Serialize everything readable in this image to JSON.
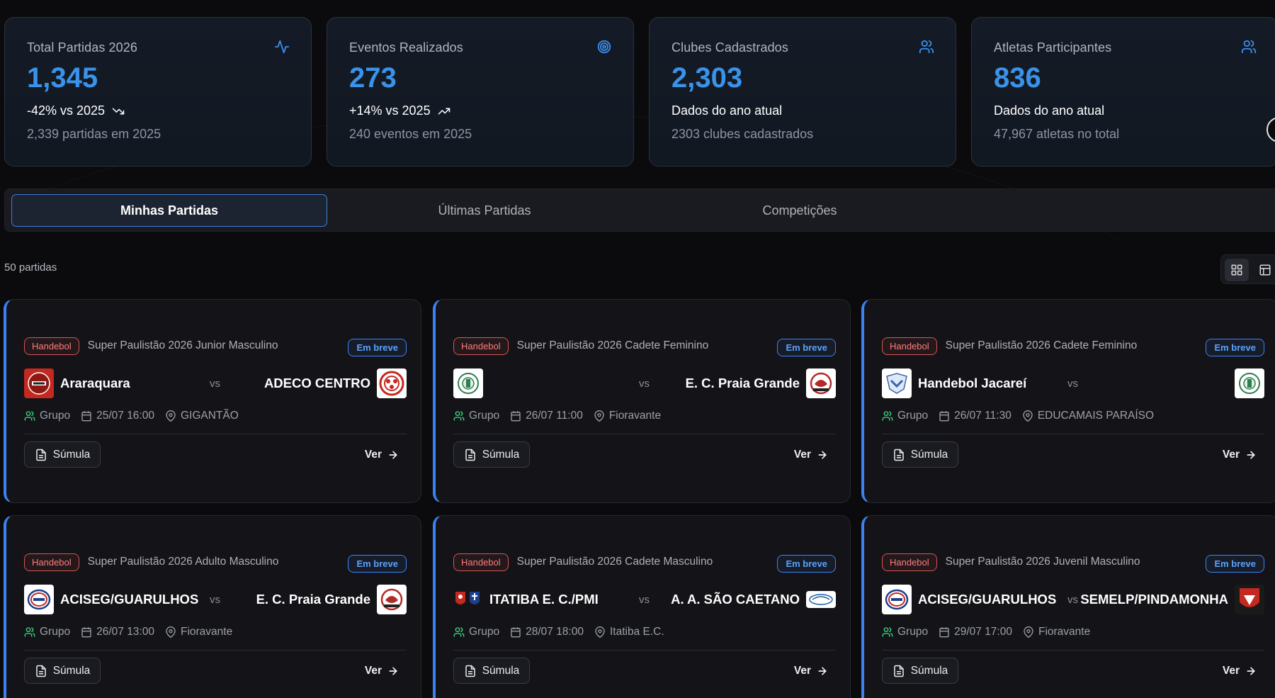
{
  "stats": [
    {
      "title": "Total Partidas 2026",
      "value": "1,345",
      "trend": "-42% vs 2025",
      "trend_dir": "down",
      "sub": "2,339 partidas em 2025",
      "icon": "activity-icon"
    },
    {
      "title": "Eventos Realizados",
      "value": "273",
      "trend": "+14% vs 2025",
      "trend_dir": "up",
      "sub": "240 eventos em 2025",
      "icon": "target-icon"
    },
    {
      "title": "Clubes Cadastrados",
      "value": "2,303",
      "trend": "Dados do ano atual",
      "sub": "2303 clubes cadastrados",
      "icon": "users-icon"
    },
    {
      "title": "Atletas Participantes",
      "value": "836",
      "trend": "Dados do ano atual",
      "sub": "47,967 atletas no total",
      "icon": "users-icon"
    }
  ],
  "tabs": [
    {
      "label": "Minhas Partidas",
      "active": true
    },
    {
      "label": "Últimas Partidas",
      "active": false
    },
    {
      "label": "Competições",
      "active": false
    }
  ],
  "count_label": "50 partidas",
  "accent": "#3b82f6",
  "matches": [
    {
      "sport": "Handebol",
      "competition": "Super Paulistão 2026 Junior Masculino",
      "status": "Em breve",
      "home": "Araraquara",
      "away": "ADECO CENTRO",
      "vs": "vs",
      "phase": "Grupo",
      "datetime": "25/07 16:00",
      "venue": "GIGANTÃO",
      "sumula": "Súmula",
      "ver": "Ver"
    },
    {
      "sport": "Handebol",
      "competition": "Super Paulistão 2026 Cadete Feminino",
      "status": "Em breve",
      "home": "",
      "away": "E. C. Praia Grande",
      "vs": "vs",
      "phase": "Grupo",
      "datetime": "26/07 11:00",
      "venue": "Fioravante",
      "sumula": "Súmula",
      "ver": "Ver"
    },
    {
      "sport": "Handebol",
      "competition": "Super Paulistão 2026 Cadete Feminino",
      "status": "Em breve",
      "home": "Handebol Jacareí",
      "away": "",
      "vs": "vs",
      "phase": "Grupo",
      "datetime": "26/07 11:30",
      "venue": "EDUCAMAIS PARAÍSO",
      "sumula": "Súmula",
      "ver": "Ver"
    },
    {
      "sport": "Handebol",
      "competition": "Super Paulistão 2026 Adulto Masculino",
      "status": "Em breve",
      "home": "ACISEG/GUARULHOS",
      "away": "E. C. Praia Grande",
      "vs": "vs",
      "phase": "Grupo",
      "datetime": "26/07 13:00",
      "venue": "Fioravante",
      "sumula": "Súmula",
      "ver": "Ver"
    },
    {
      "sport": "Handebol",
      "competition": "Super Paulistão 2026 Cadete Masculino",
      "status": "Em breve",
      "home": "ITATIBA E. C./PMI",
      "away": "A. A. SÃO CAETANO",
      "vs": "vs",
      "phase": "Grupo",
      "datetime": "28/07 18:00",
      "venue": "Itatiba E.C.",
      "sumula": "Súmula",
      "ver": "Ver"
    },
    {
      "sport": "Handebol",
      "competition": "Super Paulistão 2026 Juvenil Masculino",
      "status": "Em breve",
      "home": "ACISEG/GUARULHOS",
      "away": "SEMELP/PINDAMONHA",
      "vs": "vs",
      "phase": "Grupo",
      "datetime": "29/07 17:00",
      "venue": "Fioravante",
      "sumula": "Súmula",
      "ver": "Ver"
    }
  ]
}
